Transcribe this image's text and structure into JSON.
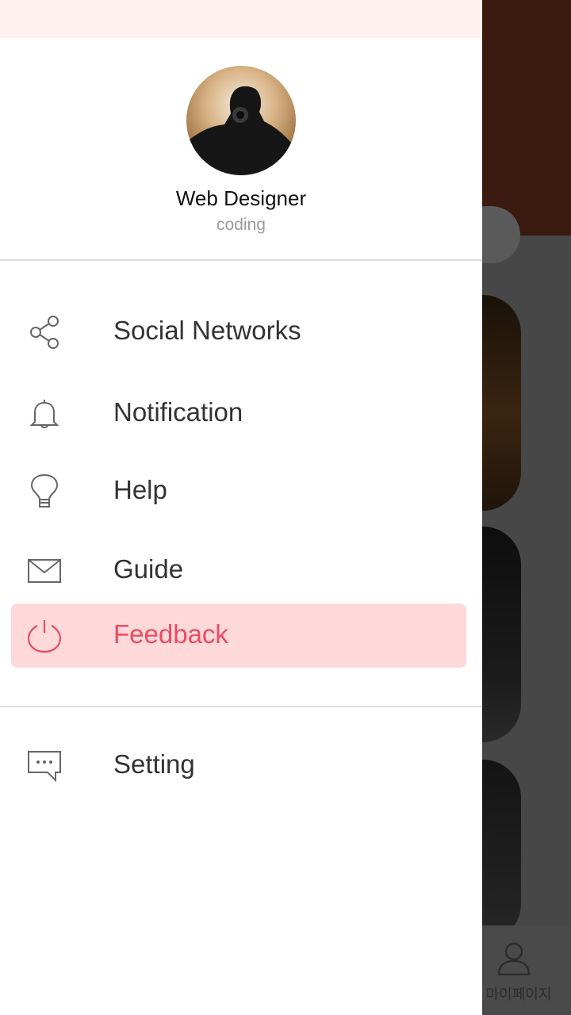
{
  "profile": {
    "name": "Web Designer",
    "subtitle": "coding"
  },
  "menu": [
    {
      "label": "Social Networks",
      "icon": "share-icon"
    },
    {
      "label": "Notification",
      "icon": "bell-icon"
    },
    {
      "label": "Help",
      "icon": "lightbulb-icon"
    },
    {
      "label": "Guide",
      "icon": "mail-icon"
    },
    {
      "label": "Feedback",
      "icon": "power-icon",
      "active": true
    }
  ],
  "setting": {
    "label": "Setting",
    "icon": "chat-icon"
  },
  "background_app": {
    "bottom_nav_mypage": "마이페이지"
  },
  "colors": {
    "accent": "#ee4a62",
    "active_bg": "#fdd9d9",
    "status_tint": "#fff1f0"
  }
}
